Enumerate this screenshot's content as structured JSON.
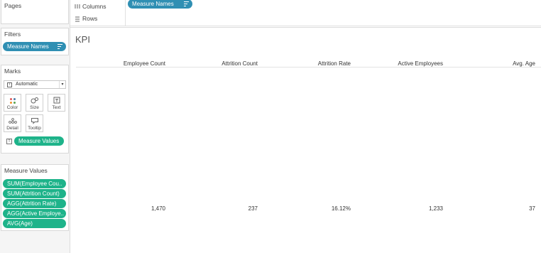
{
  "pages": {
    "title": "Pages"
  },
  "filters": {
    "title": "Filters",
    "pill": "Measure Names"
  },
  "marks": {
    "title": "Marks",
    "mark_type": "Automatic",
    "buttons": {
      "color": "Color",
      "size": "Size",
      "text": "Text",
      "detail": "Detail",
      "tooltip": "Tooltip"
    },
    "text_pill": "Measure Values"
  },
  "measure_values": {
    "title": "Measure Values",
    "items": [
      "SUM(Employee Cou..",
      "SUM(Attrition Count)",
      "AGG(Attrition Rate)",
      "AGG(Active Employe..",
      "AVG(Age)"
    ]
  },
  "shelves": {
    "columns_label": "Columns",
    "columns_pill": "Measure Names",
    "rows_label": "Rows"
  },
  "view": {
    "title": "KPI",
    "headers": [
      "Employee Count",
      "Attrition Count",
      "Attrition Rate",
      "Active Employees",
      "Avg. Age"
    ],
    "values": [
      "1,470",
      "237",
      "16.12%",
      "1,233",
      "37"
    ]
  },
  "colors": {
    "blue_pill": "#2f8fb3",
    "green_pill": "#1eb38a"
  }
}
